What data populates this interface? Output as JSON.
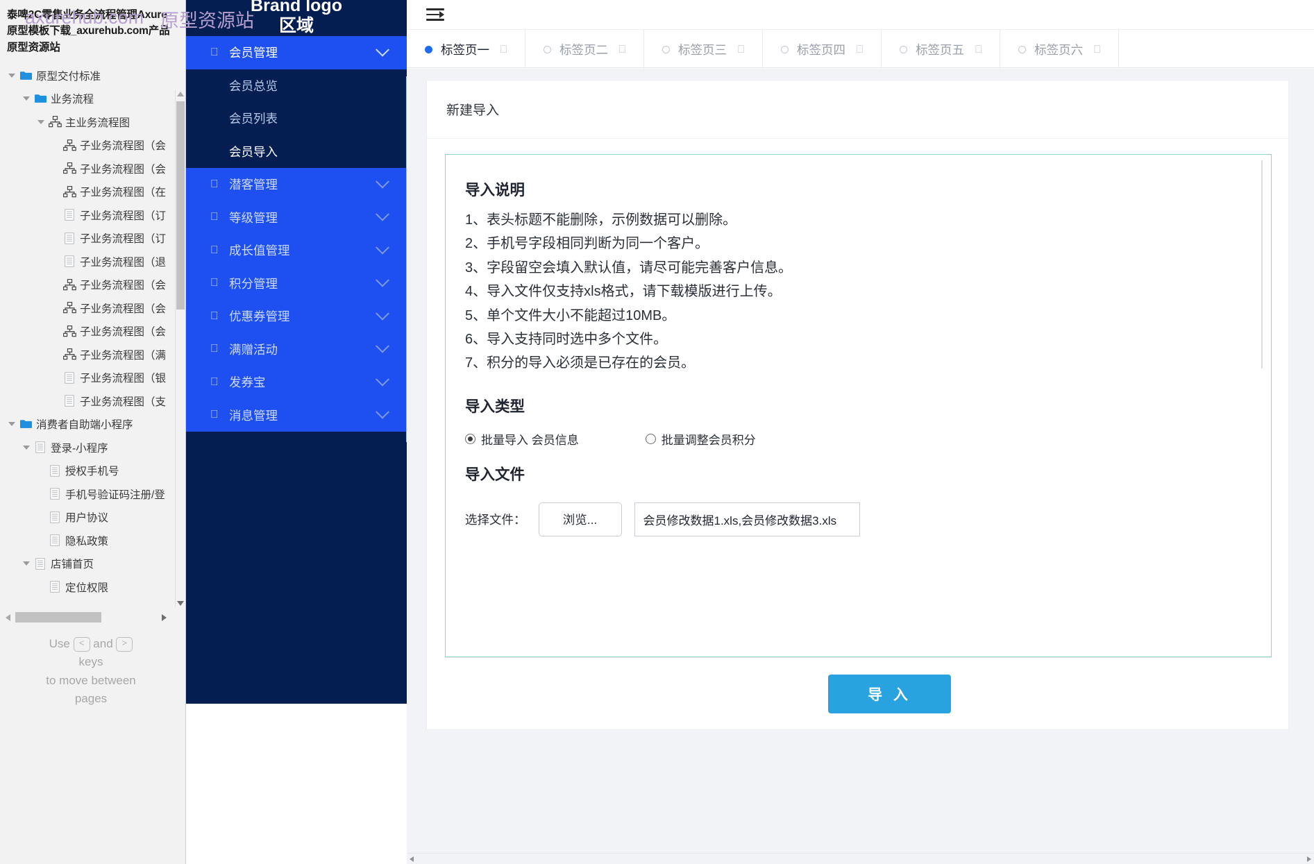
{
  "axure": {
    "project_title": "泰啤2C零售业务全流程管理Axure原型模板下载_axurehub.com产品原型资源站",
    "watermark_left": "axurehub.com",
    "watermark_right": "原型资源站",
    "tree": [
      {
        "label": "原型交付标准",
        "icon": "folder-icon",
        "indent": 0,
        "caret": true
      },
      {
        "label": "业务流程",
        "icon": "folder-icon",
        "indent": 1,
        "caret": true
      },
      {
        "label": "主业务流程图",
        "icon": "flow-icon",
        "indent": 2,
        "caret": true
      },
      {
        "label": "子业务流程图（会",
        "icon": "flow-icon",
        "indent": 3,
        "caret": false
      },
      {
        "label": "子业务流程图（会",
        "icon": "flow-icon",
        "indent": 3,
        "caret": false
      },
      {
        "label": "子业务流程图（在",
        "icon": "flow-icon",
        "indent": 3,
        "caret": false
      },
      {
        "label": "子业务流程图（订",
        "icon": "page-icon",
        "indent": 3,
        "caret": false
      },
      {
        "label": "子业务流程图（订",
        "icon": "page-icon",
        "indent": 3,
        "caret": false
      },
      {
        "label": "子业务流程图（退",
        "icon": "page-icon",
        "indent": 3,
        "caret": false
      },
      {
        "label": "子业务流程图（会",
        "icon": "flow-icon",
        "indent": 3,
        "caret": false
      },
      {
        "label": "子业务流程图（会",
        "icon": "flow-icon",
        "indent": 3,
        "caret": false
      },
      {
        "label": "子业务流程图（会",
        "icon": "flow-icon",
        "indent": 3,
        "caret": false
      },
      {
        "label": "子业务流程图（满",
        "icon": "flow-icon",
        "indent": 3,
        "caret": false
      },
      {
        "label": "子业务流程图（银",
        "icon": "page-icon",
        "indent": 3,
        "caret": false
      },
      {
        "label": "子业务流程图（支",
        "icon": "page-icon",
        "indent": 3,
        "caret": false
      },
      {
        "label": "消费者自助端小程序",
        "icon": "folder-icon",
        "indent": 0,
        "caret": true
      },
      {
        "label": "登录-小程序",
        "icon": "page-icon",
        "indent": 1,
        "caret": true
      },
      {
        "label": "授权手机号",
        "icon": "page-icon",
        "indent": 2,
        "caret": false
      },
      {
        "label": "手机号验证码注册/登",
        "icon": "page-icon",
        "indent": 2,
        "caret": false
      },
      {
        "label": "用户协议",
        "icon": "page-icon",
        "indent": 2,
        "caret": false
      },
      {
        "label": "隐私政策",
        "icon": "page-icon",
        "indent": 2,
        "caret": false
      },
      {
        "label": "店铺首页",
        "icon": "page-icon",
        "indent": 1,
        "caret": true
      },
      {
        "label": "定位权限",
        "icon": "page-icon",
        "indent": 2,
        "caret": false
      }
    ],
    "page_hint": {
      "prefix": "Use",
      "key_prev": "<",
      "conjunction": "and",
      "key_next": ">",
      "line2": "keys",
      "line3": "to move between",
      "line4": "pages"
    }
  },
  "app_nav": {
    "brand": "Brand logo区域",
    "items": [
      {
        "label": "会员管理",
        "state": "active",
        "expandable": true
      },
      {
        "label": "会员总览",
        "state": "sub",
        "expandable": false
      },
      {
        "label": "会员列表",
        "state": "sub",
        "expandable": false
      },
      {
        "label": "会员导入",
        "state": "sub-selected",
        "expandable": false
      },
      {
        "label": "潜客管理",
        "state": "blue",
        "expandable": true
      },
      {
        "label": "等级管理",
        "state": "blue",
        "expandable": true
      },
      {
        "label": "成长值管理",
        "state": "blue",
        "expandable": true
      },
      {
        "label": "积分管理",
        "state": "blue",
        "expandable": true
      },
      {
        "label": "优惠券管理",
        "state": "blue",
        "expandable": true
      },
      {
        "label": "满赠活动",
        "state": "blue",
        "expandable": true
      },
      {
        "label": "发券宝",
        "state": "blue",
        "expandable": true
      },
      {
        "label": "消息管理",
        "state": "blue",
        "expandable": true
      }
    ],
    "accent_color": "#e8b93c",
    "active_color": "#1e4ff0",
    "base_color": "#051e52"
  },
  "topbar": {
    "menu_toggle_icon": "menu-collapse-icon"
  },
  "tabs": [
    {
      "label": "标签页一",
      "active": true,
      "close_icon": "close-icon"
    },
    {
      "label": "标签页二",
      "active": false,
      "close_icon": "close-icon"
    },
    {
      "label": "标签页三",
      "active": false,
      "close_icon": "close-icon"
    },
    {
      "label": "标签页四",
      "active": false,
      "close_icon": "close-icon"
    },
    {
      "label": "标签页五",
      "active": false,
      "close_icon": "close-icon"
    },
    {
      "label": "标签页六",
      "active": false,
      "close_icon": "close-icon"
    }
  ],
  "page": {
    "card_title": "新建导入",
    "instructions_title": "导入说明",
    "instructions": [
      "1、表头标题不能删除，示例数据可以删除。",
      "2、手机号字段相同判断为同一个客户。",
      "3、字段留空会填入默认值，请尽可能完善客户信息。",
      "4、导入文件仅支持xls格式，请下载模版进行上传。",
      "5、单个文件大小不能超过10MB。",
      "6、导入支持同时选中多个文件。",
      "7、积分的导入必须是已存在的会员。"
    ],
    "import_type_title": "导入类型",
    "import_type_options": [
      {
        "label": "批量导入 会员信息",
        "checked": true
      },
      {
        "label": "批量调整会员积分",
        "checked": false
      }
    ],
    "import_file_title": "导入文件",
    "file_label": "选择文件：",
    "browse_button": "浏览...",
    "file_value": "会员修改数据1.xls,会员修改数据3.xls",
    "import_button": "导 入",
    "accent_button_color": "#29a3e0",
    "info_border_color": "#8fd2c9"
  }
}
